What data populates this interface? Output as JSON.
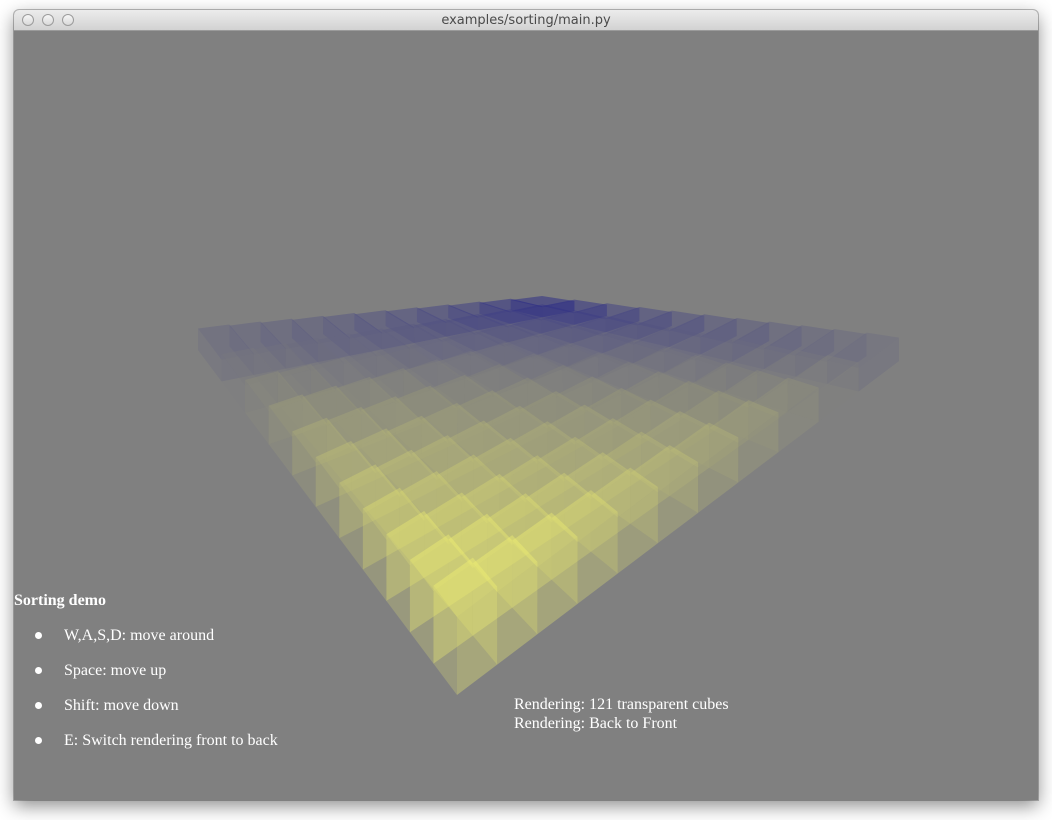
{
  "window": {
    "title": "examples/sorting/main.py"
  },
  "scene": {
    "grid_size": 11,
    "cube_count": 121,
    "colors": {
      "background": "#808080",
      "near": "#f5f570",
      "far": "#0a0a8a"
    }
  },
  "hud": {
    "title": "Sorting demo",
    "instructions": [
      "W,A,S,D: move around",
      "Space: move up",
      "Shift: move down",
      "E: Switch rendering front to back"
    ],
    "status_lines": [
      "Rendering: 121 transparent cubes",
      "Rendering: Back to Front"
    ]
  }
}
